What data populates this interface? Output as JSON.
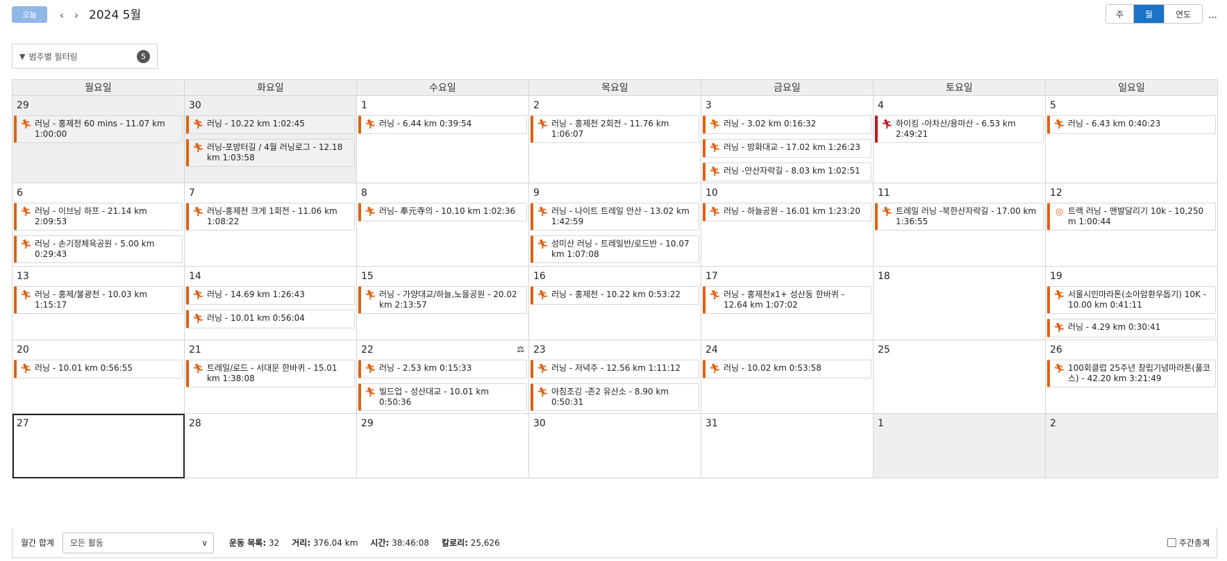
{
  "toolbar": {
    "today_label": "오늘",
    "month_title": "2024 5월",
    "views": [
      {
        "label": "주",
        "active": false
      },
      {
        "label": "월",
        "active": true
      },
      {
        "label": "연도",
        "active": false
      }
    ],
    "more_label": "..."
  },
  "filter": {
    "label": "범주별 필터링",
    "count": "5"
  },
  "calendar": {
    "weekdays": [
      "월요일",
      "화요일",
      "수요일",
      "목요일",
      "금요일",
      "토요일",
      "일요일"
    ],
    "weeks": [
      {
        "days": [
          {
            "num": "29",
            "other": true,
            "events": [
              {
                "icon": "running-icon",
                "text": "러닝 - 홍제천 60 mins - 11.07 km 1:00:00"
              }
            ]
          },
          {
            "num": "30",
            "other": true,
            "events": [
              {
                "icon": "running-icon",
                "text": "러닝 - 10.22 km 1:02:45"
              },
              {
                "icon": "running-icon",
                "text": "러닝-포방터길 / 4월 러닝로그 - 12.18 km 1:03:58"
              }
            ]
          },
          {
            "num": "1",
            "events": [
              {
                "icon": "running-icon",
                "text": "러닝 - 6.44 km 0:39:54"
              }
            ]
          },
          {
            "num": "2",
            "events": [
              {
                "icon": "running-icon",
                "text": "러닝 - 홍제천 2회전 - 11.76 km 1:06:07"
              }
            ]
          },
          {
            "num": "3",
            "events": [
              {
                "icon": "running-icon",
                "text": "러닝 - 3.02 km 0:16:32"
              },
              {
                "icon": "running-icon",
                "text": "러닝 - 방화대교 - 17.02 km 1:26:23"
              },
              {
                "icon": "running-icon",
                "text": "러닝 -안산자락길 - 8.03 km 1:02:51"
              }
            ]
          },
          {
            "num": "4",
            "events": [
              {
                "icon": "hiking-icon",
                "text": "하이킹 -아차산/용마산 - 6.53 km 2:49:21"
              }
            ]
          },
          {
            "num": "5",
            "events": [
              {
                "icon": "running-icon",
                "text": "러닝 - 6.43 km 0:40:23"
              }
            ]
          }
        ]
      },
      {
        "days": [
          {
            "num": "6",
            "events": [
              {
                "icon": "running-icon",
                "text": "러닝 - 이브닝 하프 - 21.14 km 2:09:53"
              },
              {
                "icon": "running-icon",
                "text": "러닝 - 손기정체육공원 - 5.00 km 0:29:43"
              }
            ]
          },
          {
            "num": "7",
            "events": [
              {
                "icon": "running-icon",
                "text": "러닝-홍제천 크게 1회전 - 11.06 km 1:08:22"
              }
            ]
          },
          {
            "num": "8",
            "events": [
              {
                "icon": "running-icon",
                "text": "러닝- 奉元寺의 - 10.10 km 1:02:36"
              }
            ]
          },
          {
            "num": "9",
            "events": [
              {
                "icon": "running-icon",
                "text": "러닝 - 나이트 트레일 안산 - 13.02 km 1:42:59"
              },
              {
                "icon": "running-icon",
                "text": "성미산 러닝 - 트레일반/로드반 - 10.07 km 1:07:08"
              }
            ]
          },
          {
            "num": "10",
            "events": [
              {
                "icon": "running-icon",
                "text": "러닝 - 하늘공원 - 16.01 km 1:23:20"
              }
            ]
          },
          {
            "num": "11",
            "events": [
              {
                "icon": "trail-running-icon",
                "text": "트레일 러닝 -북한산자락길 - 17.00 km 1:36:55"
              }
            ]
          },
          {
            "num": "12",
            "events": [
              {
                "icon": "track-running-icon",
                "text": "트랙 러닝 - 맨발달리기 10k - 10,250 m 1:00:44"
              }
            ]
          }
        ]
      },
      {
        "days": [
          {
            "num": "13",
            "events": [
              {
                "icon": "running-icon",
                "text": "러닝 - 홍제/불광천 - 10.03 km 1:15:17"
              }
            ]
          },
          {
            "num": "14",
            "events": [
              {
                "icon": "running-icon",
                "text": "러닝 - 14.69 km 1:26:43"
              },
              {
                "icon": "running-icon",
                "text": "러닝 - 10.01 km 0:56:04"
              }
            ]
          },
          {
            "num": "15",
            "events": [
              {
                "icon": "running-icon",
                "text": "러닝 - 가양대교/하늘,노을공원 - 20.02 km 2:13:57"
              }
            ]
          },
          {
            "num": "16",
            "events": [
              {
                "icon": "running-icon",
                "text": "러닝 - 홍제천 - 10.22 km 0:53:22"
              }
            ]
          },
          {
            "num": "17",
            "events": [
              {
                "icon": "running-icon",
                "text": "러닝 - 홍제천x1+ 성산동 한바퀴 - 12.64 km 1:07:02"
              }
            ]
          },
          {
            "num": "18",
            "events": []
          },
          {
            "num": "19",
            "events": [
              {
                "icon": "running-icon",
                "text": "서울시민마라톤(소아암환우돕기) 10K - 10.00 km 0:41:11"
              },
              {
                "icon": "running-icon",
                "text": "러닝 - 4.29 km 0:30:41"
              }
            ]
          }
        ]
      },
      {
        "days": [
          {
            "num": "20",
            "events": [
              {
                "icon": "running-icon",
                "text": "러닝 - 10.01 km 0:56:55"
              }
            ]
          },
          {
            "num": "21",
            "events": [
              {
                "icon": "running-icon",
                "text": "트레일/로드 - 서대문 한바퀴 - 15.01 km 1:38:08"
              }
            ]
          },
          {
            "num": "22",
            "scale": true,
            "events": [
              {
                "icon": "running-icon",
                "text": "러닝 - 2.53 km 0:15:33"
              },
              {
                "icon": "running-icon",
                "text": "빌드업 - 성산대교 - 10.01 km 0:50:36"
              }
            ]
          },
          {
            "num": "23",
            "events": [
              {
                "icon": "running-icon",
                "text": "러닝 - 저녁주 - 12.56 km 1:11:12"
              },
              {
                "icon": "running-icon",
                "text": "아침조깅 -존2 유산소 - 8.90 km 0:50:31"
              }
            ]
          },
          {
            "num": "24",
            "events": [
              {
                "icon": "running-icon",
                "text": "러닝 - 10.02 km 0:53:58"
              }
            ]
          },
          {
            "num": "25",
            "events": []
          },
          {
            "num": "26",
            "events": [
              {
                "icon": "running-icon",
                "text": "100회클럽 25주년 창립기념마라톤(풀코스) - 42.20 km 3:21:49"
              }
            ]
          }
        ]
      },
      {
        "days": [
          {
            "num": "27",
            "today": true,
            "events": []
          },
          {
            "num": "28",
            "events": []
          },
          {
            "num": "29",
            "events": []
          },
          {
            "num": "30",
            "events": []
          },
          {
            "num": "31",
            "events": []
          },
          {
            "num": "1",
            "other": true,
            "events": []
          },
          {
            "num": "2",
            "other": true,
            "events": []
          }
        ]
      }
    ]
  },
  "footer": {
    "monthly_total_label": "월간 합계",
    "activity_select_value": "모든 활동",
    "stats": [
      {
        "label": "운동 목록:",
        "value": "32"
      },
      {
        "label": "거리:",
        "value": "376.04 km"
      },
      {
        "label": "시간:",
        "value": "38:46:08"
      },
      {
        "label": "칼로리:",
        "value": "25,626"
      }
    ],
    "weekly_total_label": "주간총계"
  },
  "colors": {
    "accent": "#1a73c8",
    "today_button": "#8fb8e8",
    "running": "#e06010",
    "hiking": "#c4171b",
    "other_month_bg": "#efefef"
  }
}
